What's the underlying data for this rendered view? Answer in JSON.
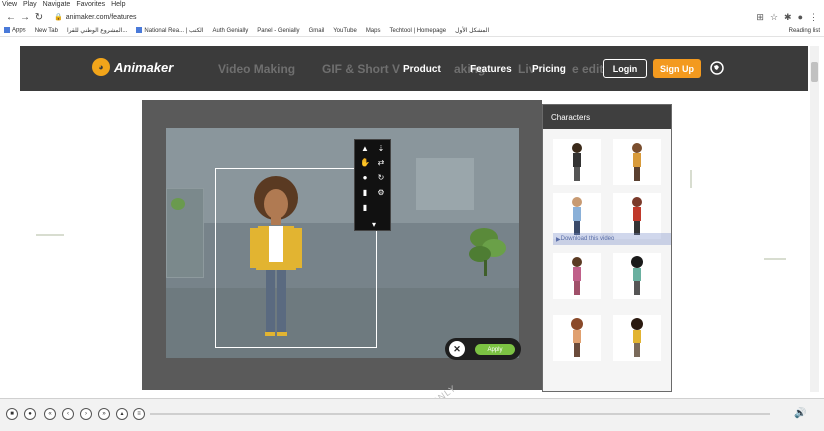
{
  "player_menu": [
    "View",
    "Play",
    "Navigate",
    "Favorites",
    "Help"
  ],
  "browser": {
    "url": "animaker.com/features",
    "bookmarks": [
      "Apps",
      "New Tab",
      "المشروع الوطني للقرا...",
      "National Rea... | الكتب",
      "Auth Genially",
      "Panel - Genially",
      "Gmail",
      "YouTube",
      "Maps",
      "Techtool | Homepage",
      "المشكل الأول"
    ],
    "reading_list": "Reading list"
  },
  "site": {
    "logo": "Animaker",
    "nav_ghost": [
      "Video Making",
      "GIF & Short V",
      "aking",
      "Features",
      "Liv",
      "e edit"
    ],
    "menu": [
      "Product",
      "Features",
      "Pricing"
    ],
    "login": "Login",
    "signup": "Sign Up"
  },
  "editor": {
    "apply": "Apply",
    "characters_title": "Characters",
    "download_banner": "Download this video"
  },
  "watermark": "ONLY",
  "colors": {
    "header_bg": "#3b3b3b",
    "signup_orange": "#f39a1f",
    "apply_green": "#7cc243",
    "editor_gray": "#5a5a5a"
  }
}
